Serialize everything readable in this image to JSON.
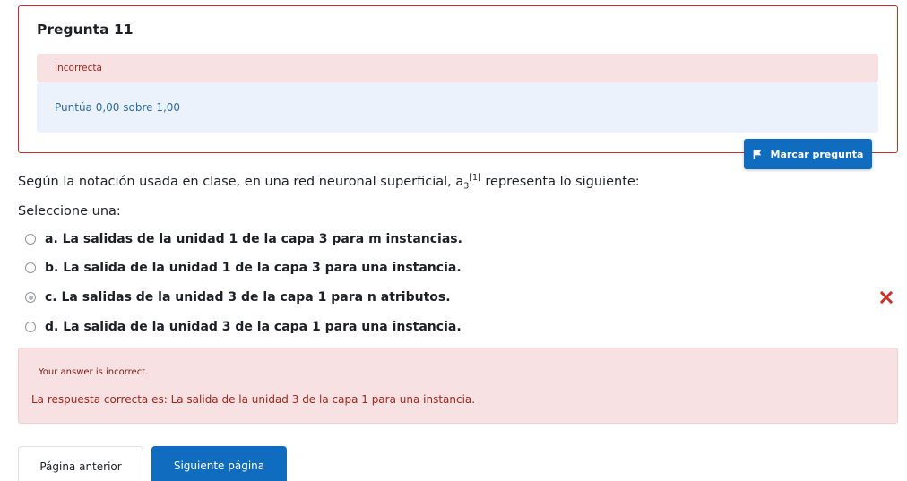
{
  "question": {
    "title": "Pregunta 11",
    "state": "Incorrecta",
    "grade": "Puntúa 0,00 sobre 1,00",
    "flag_label": "Marcar pregunta",
    "text_before": "Según la notación usada en clase, en una red neuronal superficial, a",
    "text_sub": "3",
    "text_sup": "[1]",
    "text_after": " representa lo siguiente:",
    "prompt": "Seleccione una:"
  },
  "answers": [
    {
      "label": "a. La salidas de la unidad 1 de la capa 3 para m instancias.",
      "checked": false
    },
    {
      "label": "b. La salida de la unidad 1 de la capa 3 para una instancia.",
      "checked": false
    },
    {
      "label": "c. La salidas de la unidad 3 de la capa 1 para n atributos.",
      "checked": true
    },
    {
      "label": "d. La salida de la unidad 3 de la capa 1 para una instancia.",
      "checked": false
    }
  ],
  "feedback": {
    "status": "Your answer is incorrect.",
    "right_answer": "La respuesta correcta es: La salida de la unidad 3 de la capa 1 para una instancia."
  },
  "nav": {
    "prev_label": "Página anterior",
    "next_label": "Siguiente página"
  },
  "colors": {
    "incorrect_border": "#ca3120",
    "incorrect_bg": "#f8e1e2",
    "grade_bg": "#ecf2fc",
    "primary": "#0f6cbf",
    "wrong_mark": "#ca3120"
  },
  "icons": {
    "flag": "flag-icon",
    "incorrect": "x-icon"
  }
}
